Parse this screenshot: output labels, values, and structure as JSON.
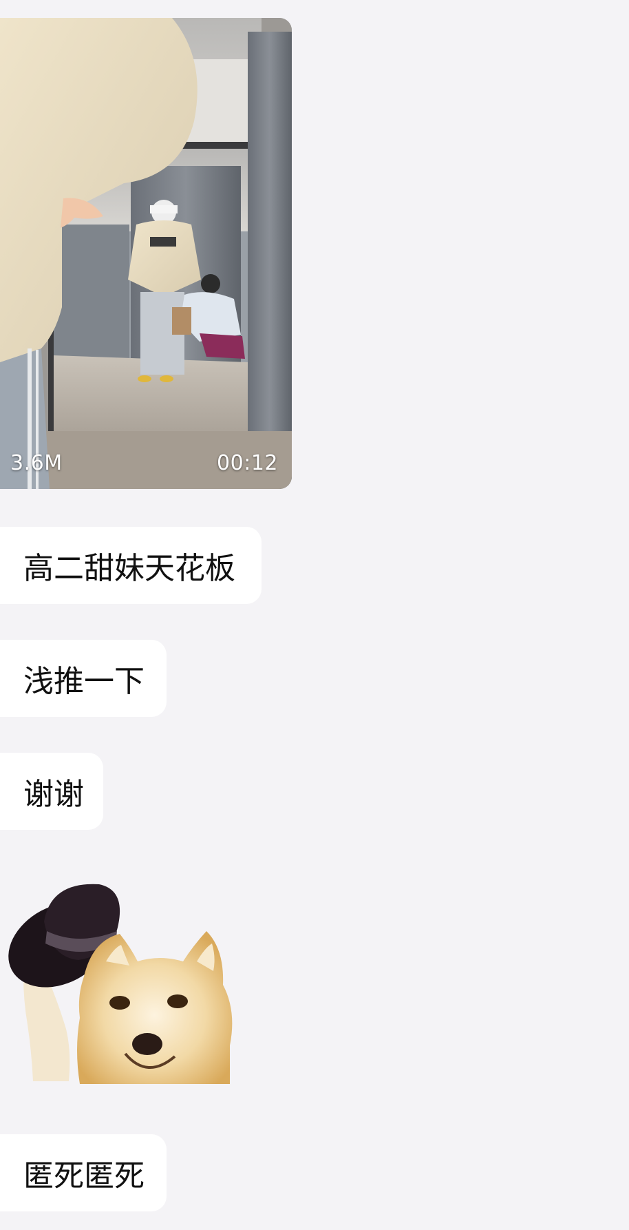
{
  "video": {
    "size": "3.6M",
    "duration": "00:12"
  },
  "messages": [
    {
      "text": "高二甜妹天花板"
    },
    {
      "text": "浅推一下"
    },
    {
      "text": "谢谢"
    },
    {
      "text": "匿死匿死"
    }
  ],
  "sticker": {
    "subject": "shiba-dog-tipping-hat"
  },
  "colors": {
    "background": "#f4f3f6",
    "bubble": "#ffffff",
    "text": "#111111"
  }
}
